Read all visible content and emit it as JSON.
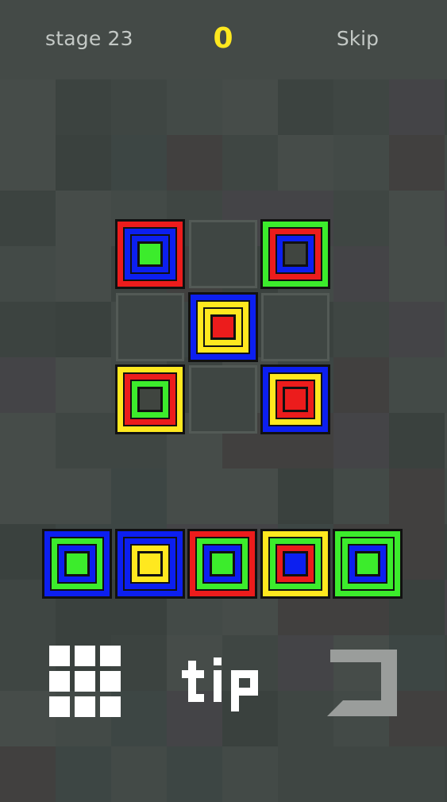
{
  "header": {
    "stage_label": "stage 23",
    "score": "0",
    "skip_label": "Skip"
  },
  "colors": {
    "red": "#ec1c1c",
    "green": "#3cec2c",
    "blue": "#0c1ff0",
    "yellow": "#ffe81f",
    "dark": "#404540",
    "score": "#ffe81f"
  },
  "board": {
    "rows": 3,
    "cols": 3,
    "cells": [
      [
        "red",
        "blue",
        "blue",
        "green"
      ],
      null,
      [
        "green",
        "red",
        "blue",
        "dark"
      ],
      null,
      [
        "blue",
        "yellow",
        "yellow",
        "red"
      ],
      null,
      [
        "yellow",
        "red",
        "green",
        "dark"
      ],
      null,
      [
        "blue",
        "yellow",
        "red",
        "red"
      ]
    ]
  },
  "tray": {
    "pieces": [
      [
        "blue",
        "green",
        "blue",
        "green"
      ],
      [
        "blue",
        "blue",
        "yellow",
        "yellow"
      ],
      [
        "red",
        "green",
        "blue",
        "green"
      ],
      [
        "yellow",
        "green",
        "red",
        "blue"
      ],
      [
        "green",
        "green",
        "blue",
        "green"
      ]
    ]
  },
  "controls": {
    "grid_icon": "grid-3x3-icon",
    "tip_icon": "tip-text-icon",
    "tip_label": "tip",
    "undo_icon": "undo-corner-icon"
  }
}
